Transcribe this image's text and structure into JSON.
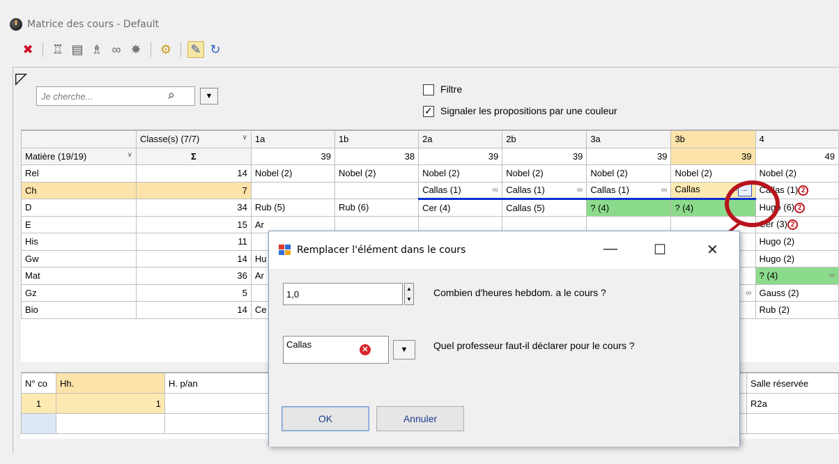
{
  "window": {
    "title": "Matrice des cours - Default"
  },
  "toolbar": [
    {
      "name": "delete-icon",
      "glyph": "✖",
      "color": "#d0102a"
    },
    {
      "name": "separator"
    },
    {
      "name": "teacher-icon",
      "glyph": "♖",
      "color": "#444"
    },
    {
      "name": "classes-icon",
      "glyph": "▤",
      "color": "#555"
    },
    {
      "name": "teacher-class-icon",
      "glyph": "♗",
      "color": "#444"
    },
    {
      "name": "link-icon",
      "glyph": "∞",
      "color": "#666"
    },
    {
      "name": "magic-icon",
      "glyph": "✸",
      "color": "#777"
    },
    {
      "name": "separator"
    },
    {
      "name": "settings-icon",
      "glyph": "⚙",
      "color": "#c89a14"
    },
    {
      "name": "separator"
    },
    {
      "name": "edit-mode-icon",
      "glyph": "✎",
      "color": "#3a5b9c",
      "active": true
    },
    {
      "name": "refresh-icon",
      "glyph": "↻",
      "color": "#2a62b8"
    }
  ],
  "search": {
    "placeholder": "Je cherche..."
  },
  "filters": {
    "filtre_label": "Filtre",
    "filtre_checked": false,
    "signal_label": "Signaler les propositions par une couleur",
    "signal_checked": true
  },
  "grid": {
    "classes_header": "Classe(s) (7/7)",
    "subject_header": "Matière (19/19)",
    "sigma": "Σ",
    "class_columns": [
      "1a",
      "1b",
      "2a",
      "2b",
      "3a",
      "3b",
      "4"
    ],
    "class_totals": [
      "39",
      "38",
      "39",
      "39",
      "39",
      "39",
      "49"
    ],
    "rows": [
      {
        "subject": "Rel",
        "sum": "14",
        "cells": [
          "Nobel (2)",
          "Nobel (2)",
          "Nobel (2)",
          "Nobel (2)",
          "Nobel (2)",
          "Nobel (2)",
          "Nobel (2)"
        ]
      },
      {
        "subject": "Ch",
        "sum": "7",
        "cells": [
          "",
          "",
          "Callas (1)",
          "Callas (1)",
          "Callas (1)",
          "Callas",
          "Callas (1)"
        ]
      },
      {
        "subject": "D",
        "sum": "34",
        "cells": [
          "Rub (5)",
          "Rub (6)",
          "Cer (4)",
          "Callas (5)",
          "? (4)",
          "? (4)",
          "Hugo (6)"
        ]
      },
      {
        "subject": "E",
        "sum": "15",
        "cells": [
          "Ar",
          "",
          "",
          "",
          "",
          "",
          "Cer (3)"
        ]
      },
      {
        "subject": "His",
        "sum": "11",
        "cells": [
          "",
          "",
          "",
          "",
          "",
          "",
          "Hugo (2)"
        ]
      },
      {
        "subject": "Gw",
        "sum": "14",
        "cells": [
          "Hu",
          "",
          "",
          "",
          "",
          "",
          "Hugo (2)"
        ]
      },
      {
        "subject": "Mat",
        "sum": "36",
        "cells": [
          "Ar",
          "",
          "",
          "",
          "",
          "",
          "? (4)"
        ]
      },
      {
        "subject": "Gz",
        "sum": "5",
        "cells": [
          "",
          "",
          "",
          "",
          "",
          "",
          "Gauss (2)"
        ]
      },
      {
        "subject": "Bio",
        "sum": "14",
        "cells": [
          "Ce",
          "",
          "",
          "",
          "",
          "",
          "Rub (2)"
        ]
      }
    ],
    "badge": "2"
  },
  "details": {
    "headers": [
      "N° co",
      "Hh.",
      "H. p/an",
      "Salle réservée"
    ],
    "row": [
      "1",
      "1",
      "",
      "R2a"
    ]
  },
  "dialog": {
    "title": "Remplacer l'élément dans le cours",
    "minimize": "—",
    "maximize": "☐",
    "close": "✕",
    "hours_value": "1,0",
    "hours_question": "Combien d'heures hebdom. a le cours ?",
    "teacher_value": "Callas",
    "teacher_question": "Quel professeur faut-il déclarer pour le cours ?",
    "ok_label": "OK",
    "cancel_label": "Annuler"
  },
  "colors": {
    "highlight_row": "#fbe3a9",
    "proposal_green": "#8cdb8c",
    "annotation_red": "#b8141c",
    "selection_blue": "#0b2fd1"
  }
}
